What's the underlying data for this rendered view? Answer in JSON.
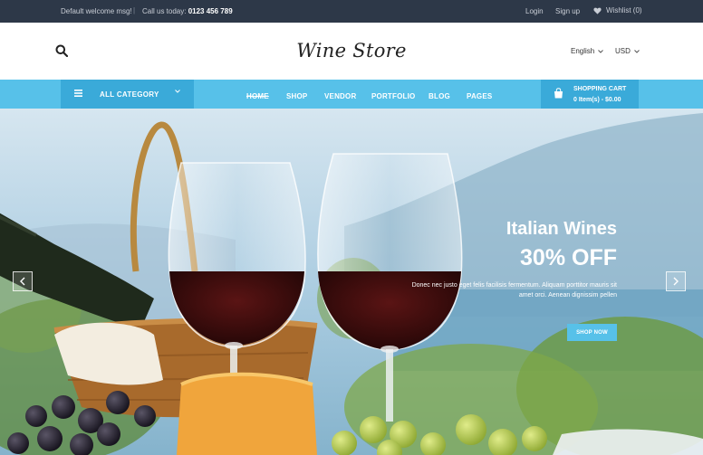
{
  "topbar": {
    "welcome": "Default welcome msg!",
    "separator": "|",
    "call_label": "Call us today:",
    "phone": "0123 456 789",
    "login": "Login",
    "signup": "Sign up",
    "wishlist": "Wishlist (0)"
  },
  "header": {
    "logo": "Wine Store",
    "language": "English",
    "currency": "USD"
  },
  "nav": {
    "all_category": "ALL CATEGORY",
    "items": [
      "HOME",
      "SHOP",
      "VENDOR",
      "PORTFOLIO",
      "BLOG",
      "PAGES"
    ],
    "active_item": "HOME",
    "cart_title": "SHOPPING CART",
    "cart_summary": "0 Item(s) - $0.00"
  },
  "hero": {
    "title": "Italian Wines",
    "discount": "30% OFF",
    "desc_line1": "Donec nec justo eget felis facilisis fermentum. Aliquam porttitor mauris sit",
    "desc_line2": "amet orci. Aenean dignissim pellen",
    "cta": "SHOP NOW"
  },
  "colors": {
    "topbar_bg": "#2d3848",
    "nav_bg": "#57c1e9",
    "nav_accent": "#3aaad9",
    "cta_bg": "#57c1e9"
  },
  "icons": [
    "search-icon",
    "heart-icon",
    "chevron-down-icon",
    "menu-icon",
    "shopping-bag-icon",
    "arrow-left-icon",
    "arrow-right-icon"
  ]
}
